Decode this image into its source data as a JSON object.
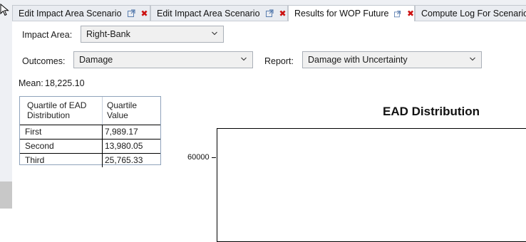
{
  "tabs": [
    {
      "label": "Edit Impact Area Scenario"
    },
    {
      "label": "Edit Impact Area Scenario"
    },
    {
      "label": "Results for WOP Future"
    },
    {
      "label": "Compute Log For Scenario: W"
    }
  ],
  "form": {
    "impact_area_label": "Impact Area:",
    "impact_area_value": "Right-Bank",
    "outcomes_label": "Outcomes:",
    "outcomes_value": "Damage",
    "report_label": "Report:",
    "report_value": "Damage with Uncertainty"
  },
  "mean": {
    "label": "Mean:",
    "value": "18,225.10"
  },
  "quartile_table": {
    "header_col1": "Quartile of EAD Distribution",
    "header_col2": "Quartile Value",
    "rows": [
      {
        "quartile": "First",
        "value": "7,989.17"
      },
      {
        "quartile": "Second",
        "value": "13,980.05"
      },
      {
        "quartile": "Third",
        "value": "25,765.33"
      }
    ]
  },
  "chart": {
    "title": "EAD Distribution",
    "y_tick_label": "60000"
  },
  "colors": {
    "close_icon": "#cc1111",
    "tab_bg": "#e9ecf1",
    "active_tab_bg": "#ffffff",
    "strip_bg": "#eef0f4"
  }
}
